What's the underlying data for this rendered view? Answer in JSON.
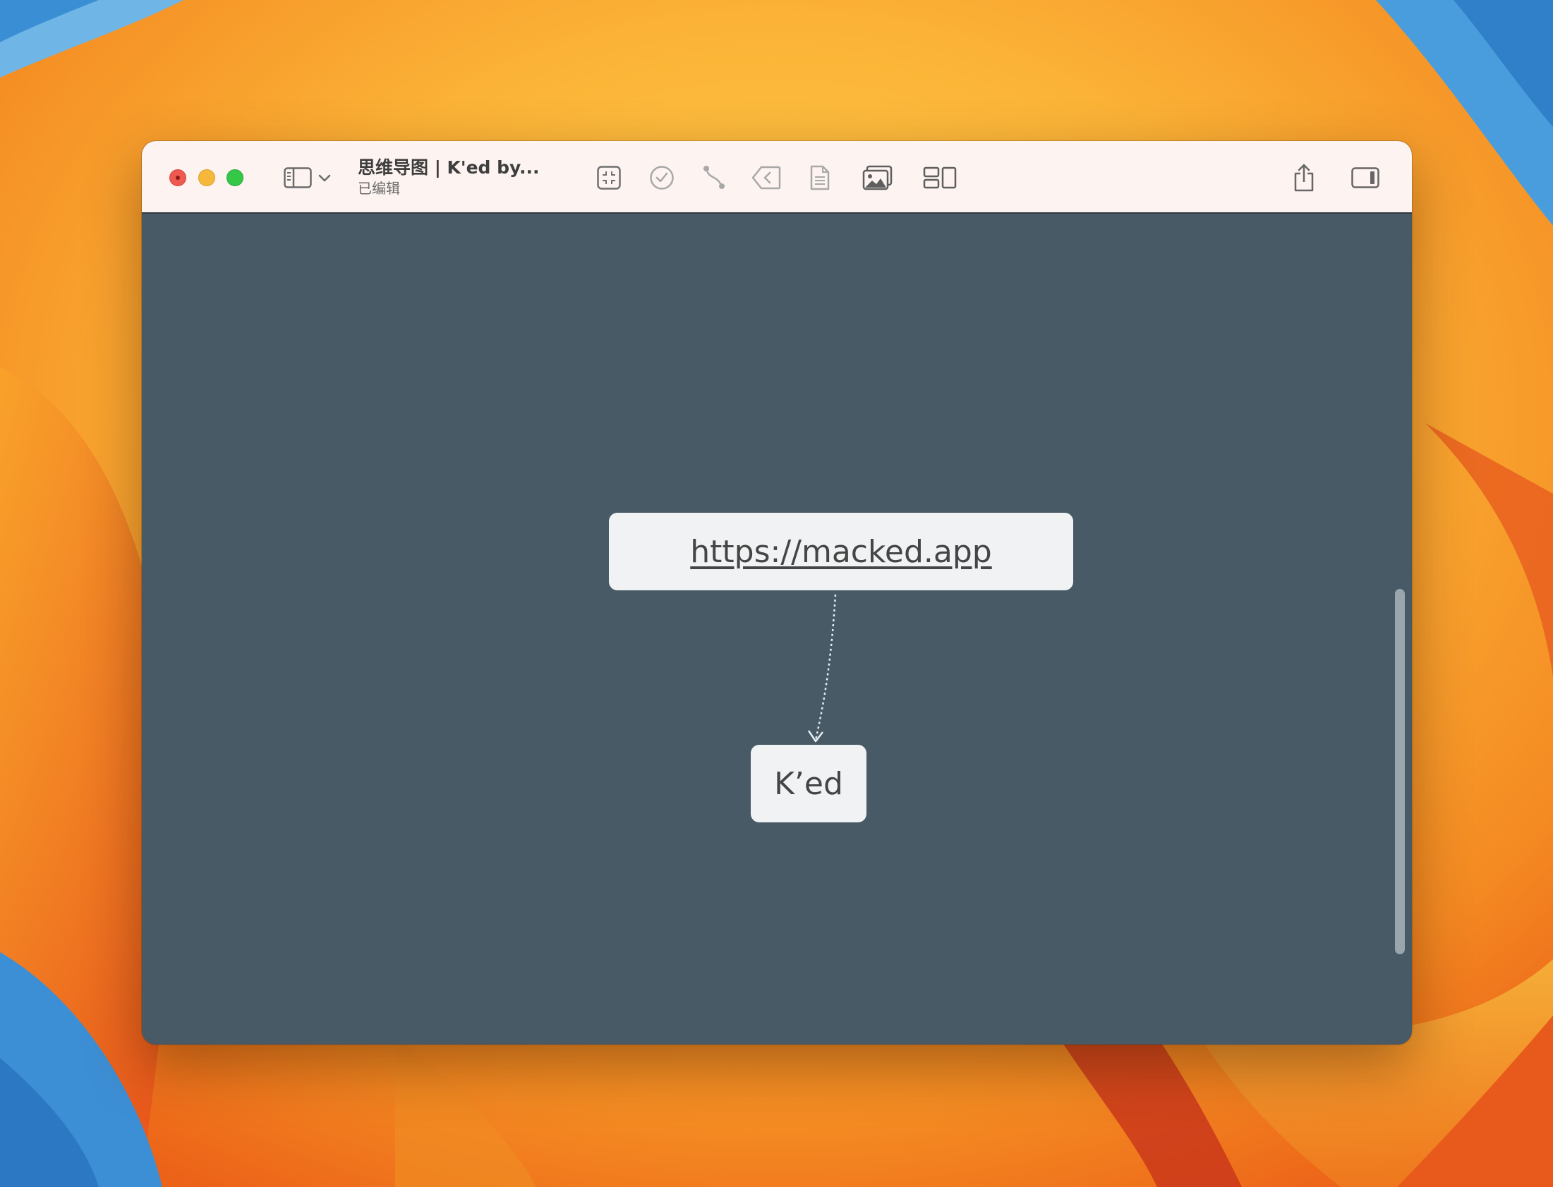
{
  "window": {
    "title": "思维导图 | K'ed by...",
    "subtitle": "已编辑"
  },
  "toolbar": {
    "left_icons": [
      "sidebar-toggle-icon",
      "chevron-down-icon"
    ],
    "center_icons": [
      "collapse-icon",
      "checkmark-circle-icon",
      "relationship-curve-icon",
      "back-tag-icon",
      "document-icon",
      "photos-icon",
      "layout-icon"
    ],
    "right_icons": [
      "share-icon",
      "inspector-toggle-icon"
    ]
  },
  "canvas": {
    "background": "#475a66",
    "nodes": [
      {
        "id": "root",
        "text": "https://macked.app",
        "is_link": true
      },
      {
        "id": "child",
        "text": "K’ed"
      }
    ]
  },
  "colors": {
    "titlebar": "#fdf3f1",
    "node_fill": "#f1f2f4",
    "close": "#ee5a52",
    "minimize": "#f5b83a",
    "zoom": "#34c748"
  }
}
